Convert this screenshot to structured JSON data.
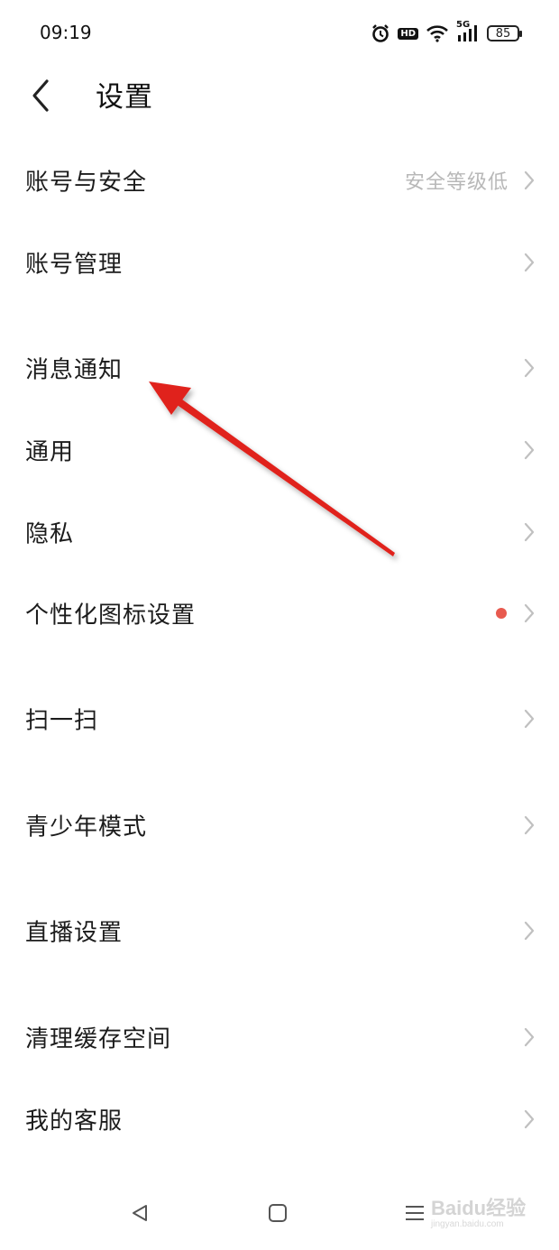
{
  "status_bar": {
    "time": "09:19",
    "icons": [
      "alarm-icon",
      "hd-icon",
      "wifi-icon",
      "5g-signal-icon",
      "battery-icon"
    ],
    "hd_label": "HD",
    "network_label": "5G",
    "battery_level": "85"
  },
  "header": {
    "back_icon": "chevron-left-icon",
    "title": "设置"
  },
  "settings": {
    "items": [
      {
        "label": "账号与安全",
        "sub": "安全等级低"
      },
      {
        "label": "账号管理"
      },
      {
        "label": "消息通知"
      },
      {
        "label": "通用"
      },
      {
        "label": "隐私"
      },
      {
        "label": "个性化图标设置",
        "badge": "red-dot"
      },
      {
        "label": "扫一扫"
      },
      {
        "label": "青少年模式"
      },
      {
        "label": "直播设置"
      },
      {
        "label": "清理缓存空间"
      },
      {
        "label": "我的客服"
      }
    ]
  },
  "nav_bar": {
    "icons": [
      "back-triangle-icon",
      "home-square-icon",
      "menu-lines-icon"
    ]
  },
  "watermark": {
    "text": "Baidu经验",
    "sub": "jingyan.baidu.com"
  },
  "colors": {
    "background": "#ffffff",
    "text": "#1c1c1c",
    "subtext": "#b8b8b8",
    "chevron": "#c0c0c0",
    "badge": "#e85a4f",
    "annotation_arrow": "#e0201a"
  }
}
